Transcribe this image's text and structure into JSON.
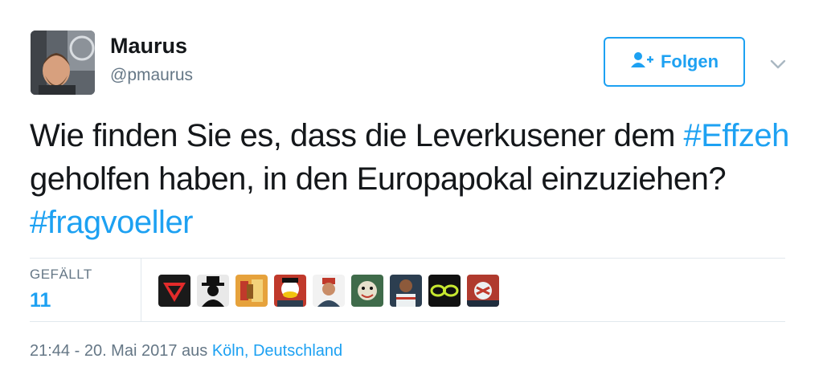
{
  "author": {
    "name": "Maurus",
    "handle": "@pmaurus"
  },
  "follow_button": {
    "label": "Folgen",
    "icon": "add-person-icon",
    "color": "#1da1f2"
  },
  "tweet": {
    "text_part1": "Wie finden Sie es, dass die Leverkusener dem ",
    "hashtag1": "#Effzeh",
    "text_part2": " geholfen haben, in den Europapokal einzuziehen? ",
    "hashtag2": "#fragvoeller"
  },
  "stats": {
    "likes_label": "GEFÄLLT",
    "likes_count": "11"
  },
  "likers": [
    "superman-avatar",
    "hat-silhouette-avatar",
    "cup-avatar",
    "duck-avatar",
    "person-avatar",
    "joker-avatar",
    "football-player-avatar",
    "goggles-avatar",
    "fan-avatar"
  ],
  "meta": {
    "time": "21:44 - 20. Mai 2017",
    "from": " aus ",
    "location": "Köln, Deutschland"
  },
  "colors": {
    "link": "#1da1f2",
    "muted": "#657786",
    "text": "#14171a"
  }
}
